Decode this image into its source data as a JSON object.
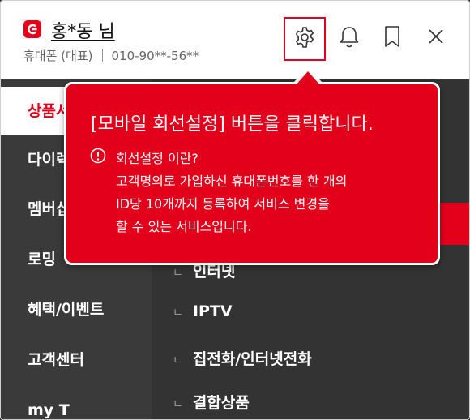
{
  "header": {
    "user_name": "홍*동 님",
    "phone_type": "휴대폰 (대표)",
    "phone_number": "010-90**-56**"
  },
  "icons": {
    "logo": "brand-logo-icon",
    "settings": "gear-icon",
    "notifications": "bell-icon",
    "bookmark": "bookmark-icon",
    "close": "close-icon",
    "info": "exclamation-circle-icon"
  },
  "colors": {
    "brand_red": "#e2001a",
    "sidebar_bg": "#3a3a3a",
    "panel_bg": "#333333"
  },
  "sidebar": {
    "items": [
      {
        "label": "상품서비스"
      },
      {
        "label": "다이렉트샵"
      },
      {
        "label": "멤버십"
      },
      {
        "label": "로밍"
      },
      {
        "label": "혜택/이벤트"
      },
      {
        "label": "고객센터"
      },
      {
        "label": "my T"
      }
    ]
  },
  "submenu": {
    "items": [
      {
        "bullet": "ㄴ",
        "label": "인터넷"
      },
      {
        "bullet": "ㄴ",
        "label": "IPTV"
      },
      {
        "bullet": "ㄴ",
        "label": "집전화/인터넷전화"
      },
      {
        "bullet": "ㄴ",
        "label": "결합상품"
      }
    ]
  },
  "tooltip": {
    "title": "[모바일 회선설정] 버튼을 클릭합니다.",
    "subtitle": "회선설정 이란?",
    "lines": [
      "고객명의로 가입하신 휴대폰번호를 한 개의",
      "ID당 10개까지 등록하여 서비스 변경을",
      "할 수 있는 서비스입니다."
    ]
  }
}
